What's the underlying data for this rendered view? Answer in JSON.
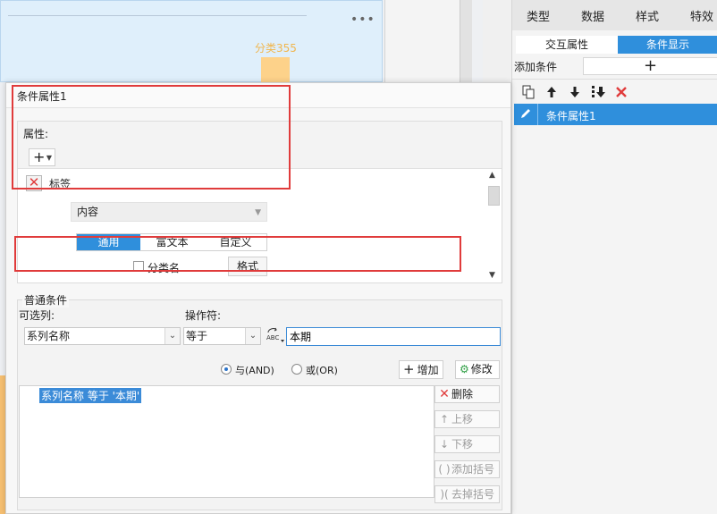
{
  "background": {
    "more_icon": "•••",
    "category_label": "分类355"
  },
  "right_panel": {
    "tabs": [
      "类型",
      "数据",
      "样式",
      "特效"
    ],
    "subtabs": [
      "交互属性",
      "条件显示"
    ],
    "add_condition_label": "添加条件",
    "add_condition_button": "+",
    "toolbar_icons": [
      "copy-icon",
      "arrow-up-icon",
      "arrow-down-icon",
      "move-bottom-icon",
      "delete-icon"
    ],
    "condition_item": "条件属性1"
  },
  "dialog": {
    "title": "条件属性1",
    "property_section": {
      "title": "属性:",
      "add_button": "+",
      "label_item": "标签",
      "content_select": "内容",
      "mode_tabs": [
        "通用",
        "富文本",
        "自定义"
      ],
      "active_mode": "通用",
      "category_name_checkbox": "分类名",
      "category_name_checked": false,
      "format_button": "格式"
    },
    "common_conditions": {
      "title": "普通条件",
      "column_label": "可选列:",
      "operator_label": "操作符:",
      "column_value": "系列名称",
      "operator_value": "等于",
      "value_input": "本期",
      "and_label": "与(AND)",
      "or_label": "或(OR)",
      "and_selected": true,
      "add_button": "增加",
      "edit_button": "修改",
      "condition_rows": [
        "系列名称 等于 '本期'"
      ],
      "side_buttons": {
        "delete": "删除",
        "move_up": "上移",
        "move_down": "下移",
        "add_bracket": "添加括号",
        "remove_bracket": "去掉括号"
      }
    }
  },
  "colors": {
    "accent": "#2f8fdc",
    "highlight_frame": "#e03b3b",
    "bar_color": "#fdd28a",
    "category_text": "#f0b64e"
  }
}
